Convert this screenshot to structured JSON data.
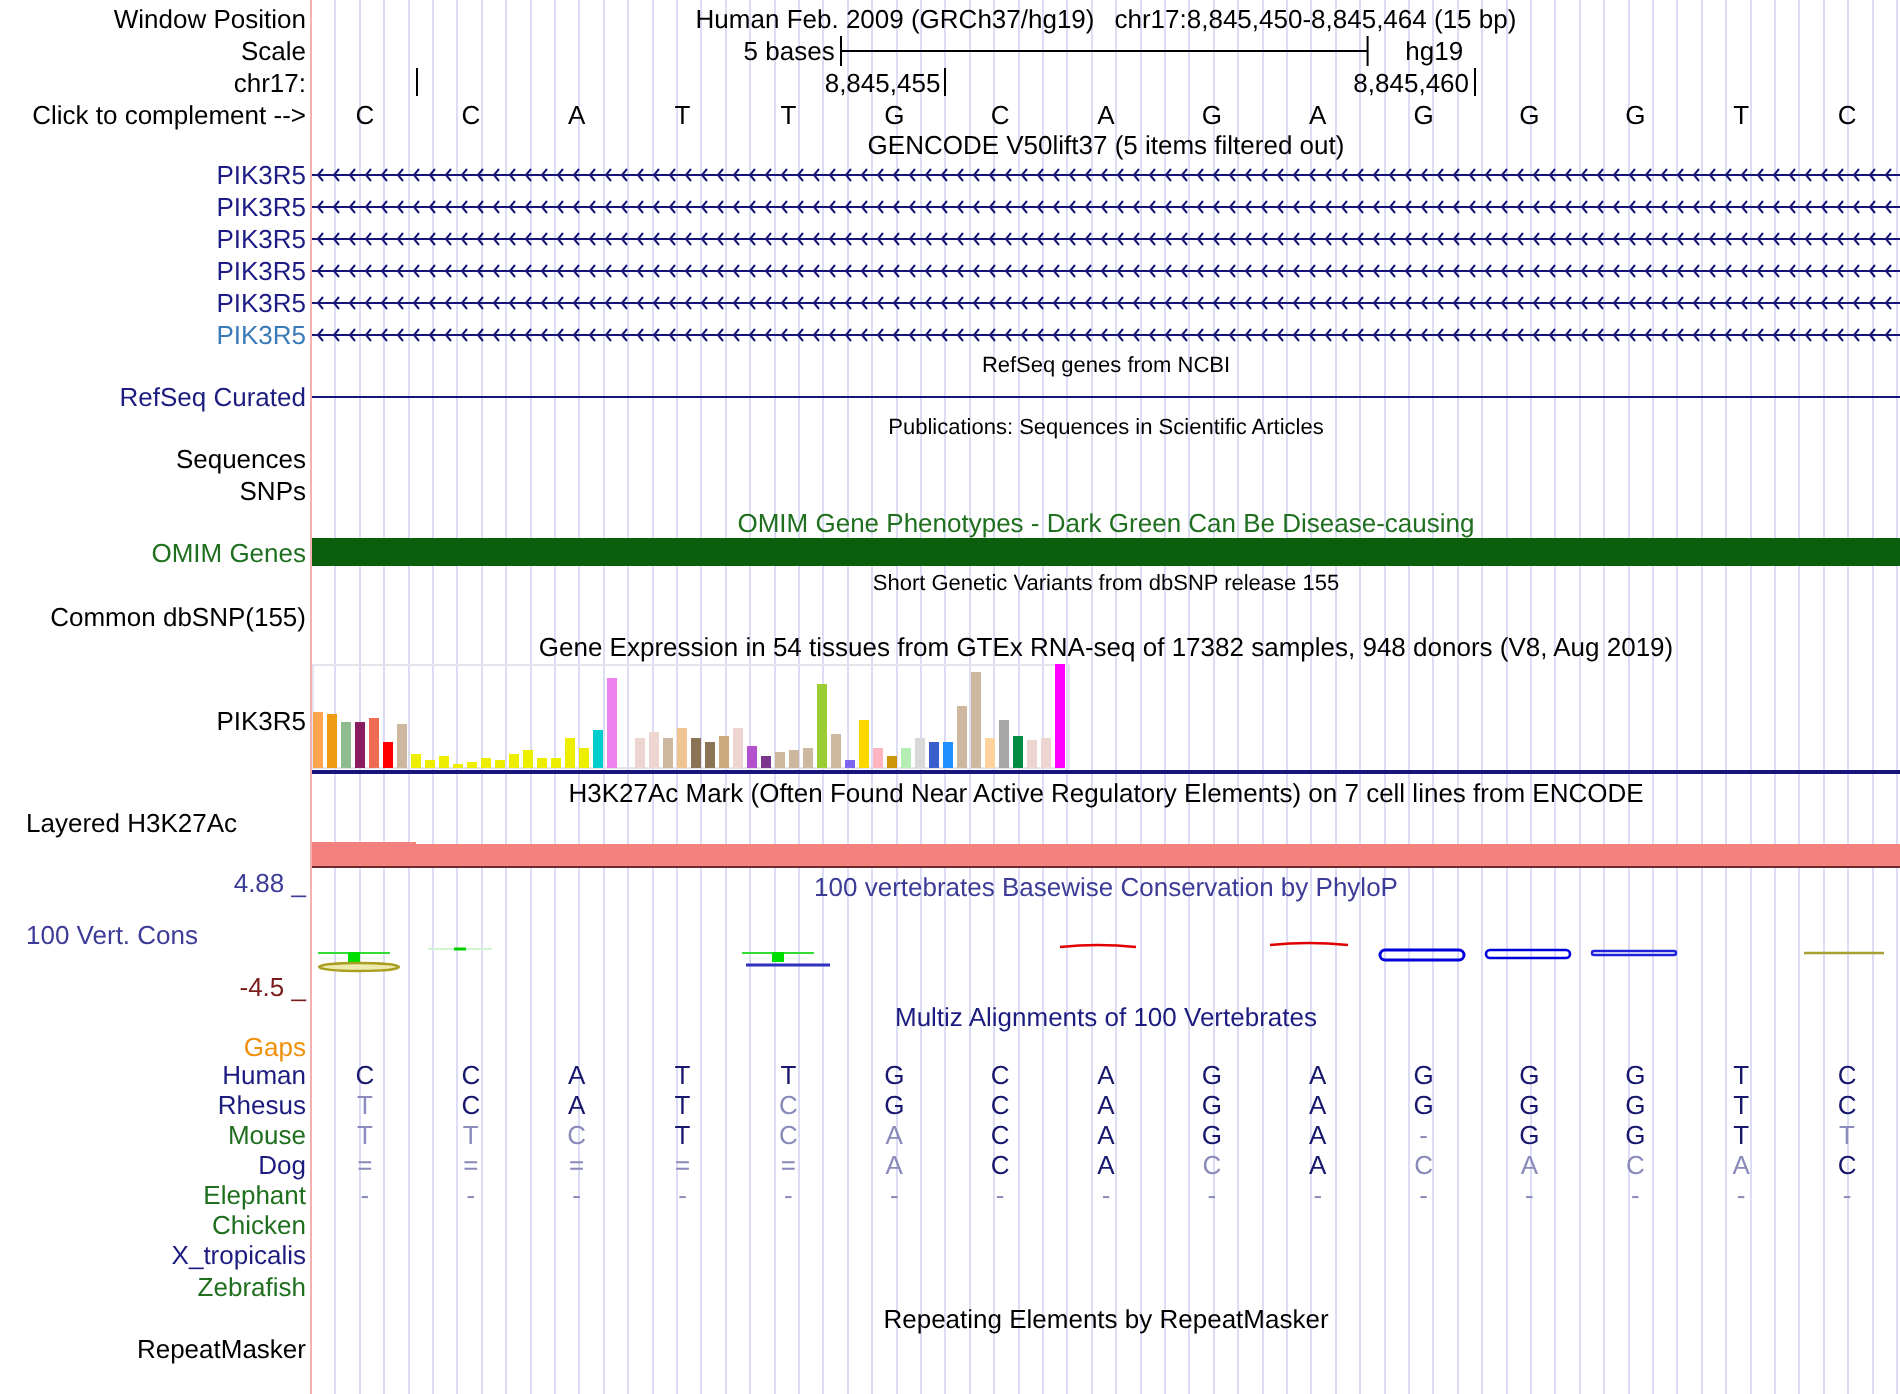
{
  "position_bar": {
    "label": "Window Position",
    "assembly": "Human Feb. 2009 (GRCh37/hg19)",
    "position": "chr17:8,845,450-8,845,464 (15 bp)"
  },
  "scale": {
    "label": "Scale",
    "span": "5 bases",
    "database": "hg19"
  },
  "coordinates": {
    "label": "chr17:",
    "ticks": [
      "8,845,455",
      "8,845,460"
    ]
  },
  "sequence": {
    "label": "Click to complement -->",
    "bases": [
      "C",
      "C",
      "A",
      "T",
      "T",
      "G",
      "C",
      "A",
      "G",
      "A",
      "G",
      "G",
      "G",
      "T",
      "C"
    ]
  },
  "gencode": {
    "title": "GENCODE V50lift37 (5 items filtered out)",
    "items": [
      {
        "label": "PIK3R5",
        "color": "#1c1c84"
      },
      {
        "label": "PIK3R5",
        "color": "#1c1c84"
      },
      {
        "label": "PIK3R5",
        "color": "#1c1c84"
      },
      {
        "label": "PIK3R5",
        "color": "#1c1c84"
      },
      {
        "label": "PIK3R5",
        "color": "#1c1c84"
      },
      {
        "label": "PIK3R5",
        "color": "#3a7ab8"
      }
    ]
  },
  "refseq": {
    "title": "RefSeq genes from NCBI",
    "label": "RefSeq Curated"
  },
  "publications": {
    "title": "Publications: Sequences in Scientific Articles",
    "label": "Sequences"
  },
  "snps": {
    "label": "SNPs"
  },
  "omim": {
    "title": "OMIM Gene Phenotypes - Dark Green Can Be Disease-causing",
    "label": "OMIM Genes"
  },
  "dbsnp": {
    "title": "Short Genetic Variants from dbSNP release 155",
    "label": "Common dbSNP(155)"
  },
  "gtex": {
    "title": "Gene Expression in 54 tissues from GTEx RNA-seq of 17382 samples, 948 donors (V8, Aug 2019)",
    "label": "PIK3R5"
  },
  "h3k27ac": {
    "title": "H3K27Ac Mark (Often Found Near Active Regulatory Elements) on 7 cell lines from ENCODE",
    "label": "Layered H3K27Ac"
  },
  "conservation": {
    "title": "100 vertebrates Basewise Conservation by PhyloP",
    "label": "100 Vert. Cons",
    "max": "4.88 _",
    "min": "-4.5 _"
  },
  "multiz": {
    "title": "Multiz Alignments of 100 Vertebrates",
    "gaps_label": "Gaps",
    "species": [
      {
        "name": "Human",
        "color": "#1c1c80",
        "bases": [
          {
            "base": "C",
            "match": true
          },
          {
            "base": "C",
            "match": true
          },
          {
            "base": "A",
            "match": true
          },
          {
            "base": "T",
            "match": true
          },
          {
            "base": "T",
            "match": true
          },
          {
            "base": "G",
            "match": true
          },
          {
            "base": "C",
            "match": true
          },
          {
            "base": "A",
            "match": true
          },
          {
            "base": "G",
            "match": true
          },
          {
            "base": "A",
            "match": true
          },
          {
            "base": "G",
            "match": true
          },
          {
            "base": "G",
            "match": true
          },
          {
            "base": "G",
            "match": true
          },
          {
            "base": "T",
            "match": true
          },
          {
            "base": "C",
            "match": true
          }
        ]
      },
      {
        "name": "Rhesus",
        "color": "#1c1c80",
        "bases": [
          {
            "base": "T",
            "match": false
          },
          {
            "base": "C",
            "match": true
          },
          {
            "base": "A",
            "match": true
          },
          {
            "base": "T",
            "match": true
          },
          {
            "base": "C",
            "match": false
          },
          {
            "base": "G",
            "match": true
          },
          {
            "base": "C",
            "match": true
          },
          {
            "base": "A",
            "match": true
          },
          {
            "base": "G",
            "match": true
          },
          {
            "base": "A",
            "match": true
          },
          {
            "base": "G",
            "match": true
          },
          {
            "base": "G",
            "match": true
          },
          {
            "base": "G",
            "match": true
          },
          {
            "base": "T",
            "match": true
          },
          {
            "base": "C",
            "match": true
          }
        ]
      },
      {
        "name": "Mouse",
        "color": "#1f6f1f",
        "bases": [
          {
            "base": "T",
            "match": false
          },
          {
            "base": "T",
            "match": false
          },
          {
            "base": "C",
            "match": false
          },
          {
            "base": "T",
            "match": true
          },
          {
            "base": "C",
            "match": false
          },
          {
            "base": "A",
            "match": false
          },
          {
            "base": "C",
            "match": true
          },
          {
            "base": "A",
            "match": true
          },
          {
            "base": "G",
            "match": true
          },
          {
            "base": "A",
            "match": true
          },
          {
            "base": "-",
            "match": false
          },
          {
            "base": "G",
            "match": true
          },
          {
            "base": "G",
            "match": true
          },
          {
            "base": "T",
            "match": true
          },
          {
            "base": "T",
            "match": false
          }
        ]
      },
      {
        "name": "Dog",
        "color": "#1c1c80",
        "bases": [
          {
            "base": "=",
            "match": false
          },
          {
            "base": "=",
            "match": false
          },
          {
            "base": "=",
            "match": false
          },
          {
            "base": "=",
            "match": false
          },
          {
            "base": "=",
            "match": false
          },
          {
            "base": "A",
            "match": false
          },
          {
            "base": "C",
            "match": true
          },
          {
            "base": "A",
            "match": true
          },
          {
            "base": "C",
            "match": false
          },
          {
            "base": "A",
            "match": true
          },
          {
            "base": "C",
            "match": false
          },
          {
            "base": "A",
            "match": false
          },
          {
            "base": "C",
            "match": false
          },
          {
            "base": "A",
            "match": false
          },
          {
            "base": "C",
            "match": true
          }
        ]
      },
      {
        "name": "Elephant",
        "color": "#1f6f1f",
        "bases": [
          {
            "base": "-",
            "match": false
          },
          {
            "base": "-",
            "match": false
          },
          {
            "base": "-",
            "match": false
          },
          {
            "base": "-",
            "match": false
          },
          {
            "base": "-",
            "match": false
          },
          {
            "base": "-",
            "match": false
          },
          {
            "base": "-",
            "match": false
          },
          {
            "base": "-",
            "match": false
          },
          {
            "base": "-",
            "match": false
          },
          {
            "base": "-",
            "match": false
          },
          {
            "base": "-",
            "match": false
          },
          {
            "base": "-",
            "match": false
          },
          {
            "base": "-",
            "match": false
          },
          {
            "base": "-",
            "match": false
          },
          {
            "base": "-",
            "match": false
          }
        ]
      },
      {
        "name": "Chicken",
        "color": "#1f6f1f"
      },
      {
        "name": "X_tropicalis",
        "color": "#1c1c80"
      },
      {
        "name": "Zebrafish",
        "color": "#1f6f1f"
      }
    ]
  },
  "repeatmasker": {
    "title": "Repeating Elements by RepeatMasker",
    "label": "RepeatMasker"
  }
}
